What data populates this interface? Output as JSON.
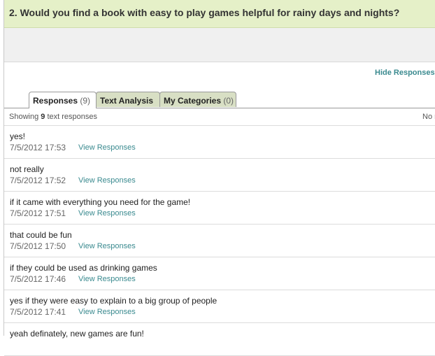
{
  "question": {
    "text": "2. Would you find a book with easy to play games helpful for rainy days and nights?"
  },
  "hide_link": "Hide Responses",
  "tabs": [
    {
      "label": "Responses",
      "count": "(9)"
    },
    {
      "label": "Text Analysis"
    },
    {
      "label": "My Categories",
      "count": "(0)"
    }
  ],
  "showing": {
    "prefix": "Showing",
    "count": "9",
    "suffix": "text responses",
    "right_label": "No r"
  },
  "responses": [
    {
      "text": "yes!",
      "timestamp": "7/5/2012 17:53",
      "link": "View Responses"
    },
    {
      "text": "not really",
      "timestamp": "7/5/2012 17:52",
      "link": "View Responses"
    },
    {
      "text": "if it came with everything you need for the game!",
      "timestamp": "7/5/2012 17:51",
      "link": "View Responses"
    },
    {
      "text": "that could be fun",
      "timestamp": "7/5/2012 17:50",
      "link": "View Responses"
    },
    {
      "text": "if they could be used as drinking games",
      "timestamp": "7/5/2012 17:46",
      "link": "View Responses"
    },
    {
      "text": "yes if they were easy to explain to a big group of people",
      "timestamp": "7/5/2012 17:41",
      "link": "View Responses"
    },
    {
      "text": "yeah definately, new games are fun!",
      "timestamp": "",
      "link": ""
    }
  ],
  "colors": {
    "question_bg": "#e5f0c8",
    "link": "#3a8a8f",
    "tab_bg": "#d8dfc4"
  }
}
